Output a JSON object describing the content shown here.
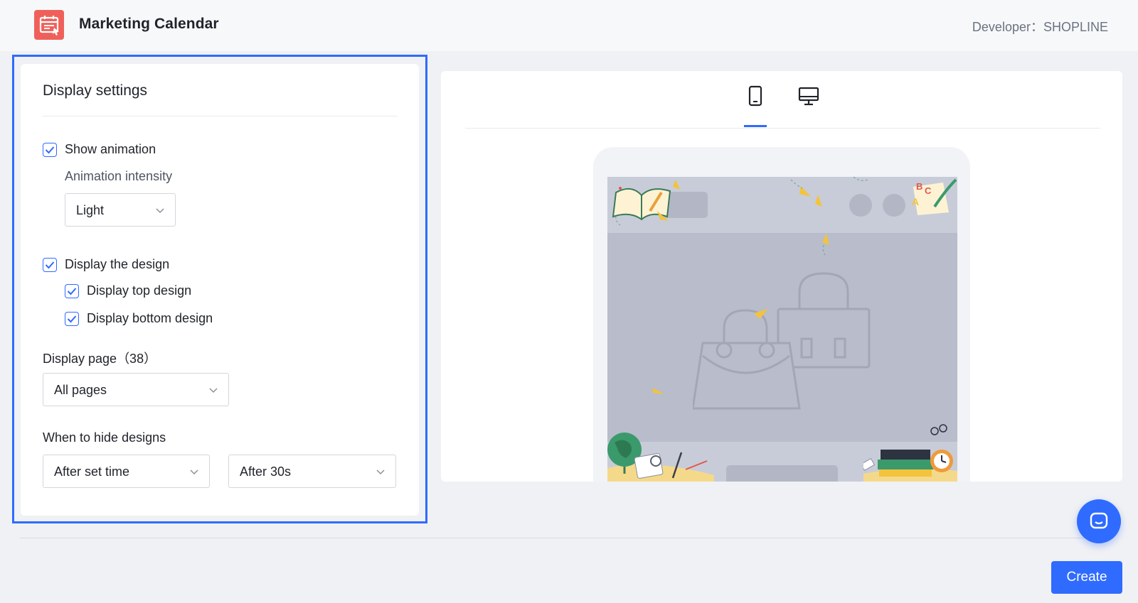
{
  "header": {
    "app_title": "Marketing Calendar",
    "developer": "Developer：SHOPLINE",
    "logo_icon": "calendar-icon",
    "logo_color": "#f0605a"
  },
  "settings": {
    "title": "Display settings",
    "show_animation": {
      "label": "Show animation",
      "checked": true
    },
    "animation_intensity": {
      "label": "Animation intensity",
      "value": "Light"
    },
    "display_design": {
      "label": "Display the design",
      "checked": true
    },
    "display_top_design": {
      "label": "Display top design",
      "checked": true
    },
    "display_bottom_design": {
      "label": "Display bottom design",
      "checked": true
    },
    "display_page": {
      "label": "Display page（38）",
      "value": "All pages"
    },
    "hide_designs": {
      "label": "When to hide designs",
      "mode_value": "After set time",
      "time_value": "After 30s"
    }
  },
  "preview": {
    "tabs": [
      {
        "icon": "mobile-icon",
        "active": true
      },
      {
        "icon": "desktop-icon",
        "active": false
      }
    ]
  },
  "footer": {
    "create_label": "Create",
    "chat_icon": "chat-icon"
  },
  "colors": {
    "accent": "#2f6bff",
    "background": "#f0f1f4"
  }
}
